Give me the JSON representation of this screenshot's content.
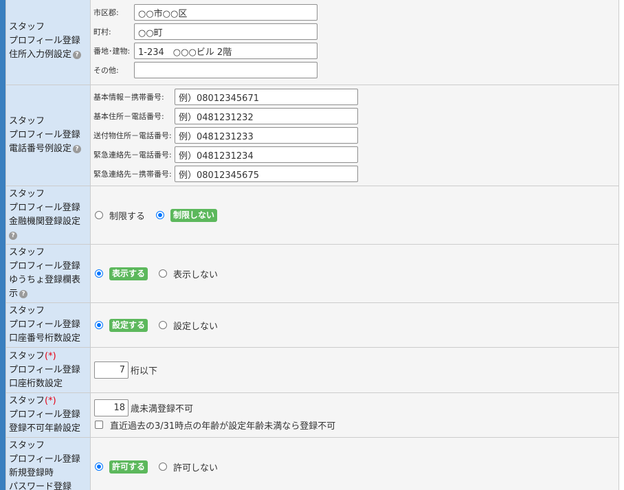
{
  "help_glyph": "?",
  "address": {
    "label": [
      "スタッフ",
      "プロフィール登録",
      "住所入力例設定"
    ],
    "fields": [
      {
        "label": "市区郡:",
        "value": "○○市○○区"
      },
      {
        "label": "町村:",
        "value": "○○町"
      },
      {
        "label": "番地･建物:",
        "value": "1-234　○○○ビル 2階"
      },
      {
        "label": "その他:",
        "value": ""
      }
    ]
  },
  "phone": {
    "label": [
      "スタッフ",
      "プロフィール登録",
      "電話番号例設定"
    ],
    "fields": [
      {
        "label": "基本情報－携帯番号:",
        "value": "例）08012345671"
      },
      {
        "label": "基本住所－電話番号:",
        "value": "例）0481231232"
      },
      {
        "label": "送付物住所－電話番号:",
        "value": "例）0481231233"
      },
      {
        "label": "緊急連絡先－電話番号:",
        "value": "例）0481231234"
      },
      {
        "label": "緊急連絡先－携帯番号:",
        "value": "例）08012345675"
      }
    ]
  },
  "bank": {
    "label": [
      "スタッフ",
      "プロフィール登録",
      "金融機関登録設定"
    ],
    "options": [
      {
        "label": "制限する",
        "selected": false
      },
      {
        "label": "制限しない",
        "selected": true
      }
    ]
  },
  "yucho": {
    "label": [
      "スタッフ",
      "プロフィール登録",
      "ゆうちょ登録欄表",
      "示"
    ],
    "options": [
      {
        "label": "表示する",
        "selected": true
      },
      {
        "label": "表示しない",
        "selected": false
      }
    ]
  },
  "account_digits_setting": {
    "label": [
      "スタッフ",
      "プロフィール登録",
      "口座番号桁数設定"
    ],
    "options": [
      {
        "label": "設定する",
        "selected": true
      },
      {
        "label": "設定しない",
        "selected": false
      }
    ]
  },
  "account_digits": {
    "label": [
      "スタッフ",
      "(*)",
      "プロフィール登録",
      "口座桁数設定"
    ],
    "value": "7",
    "unit": "桁以下"
  },
  "age_limit": {
    "label": [
      "スタッフ",
      "(*)",
      "プロフィール登録",
      "登録不可年齢設定"
    ],
    "value": "18",
    "unit": "歳未満登録不可",
    "checkbox_label": "直近過去の3/31時点の年齢が設定年齢未満なら登録不可",
    "checkbox_checked": false
  },
  "password": {
    "label": [
      "スタッフ",
      "プロフィール登録",
      "新規登録時",
      "パスワード登録"
    ],
    "options": [
      {
        "label": "許可する",
        "selected": true
      },
      {
        "label": "許可しない",
        "selected": false
      }
    ]
  }
}
